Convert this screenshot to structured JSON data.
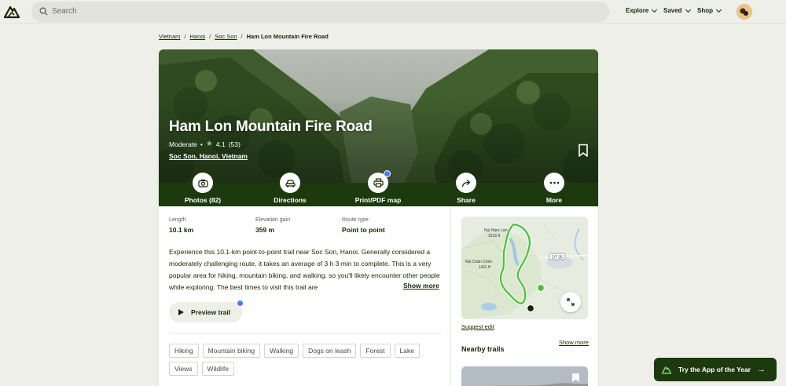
{
  "header": {
    "search_placeholder": "Search",
    "nav": [
      {
        "label": "Explore"
      },
      {
        "label": "Saved"
      },
      {
        "label": "Shop"
      }
    ]
  },
  "breadcrumb": [
    "Vietnam",
    "Hanoi",
    "Soc Son",
    "Ham Lon Mountain Fire Road"
  ],
  "trail": {
    "title": "Ham Lon Mountain Fire Road",
    "difficulty": "Moderate",
    "rating": "4.1",
    "review_count": "(53)",
    "location": "Soc Son, Hanoi, Vietnam"
  },
  "actions": [
    {
      "label": "Photos (82)",
      "icon": "camera-icon"
    },
    {
      "label": "Directions",
      "icon": "car-icon"
    },
    {
      "label": "Print/PDF map",
      "icon": "printer-icon"
    },
    {
      "label": "Share",
      "icon": "share-icon"
    },
    {
      "label": "More",
      "icon": "more-icon"
    }
  ],
  "stats": [
    {
      "label": "Length",
      "value": "10.1 km"
    },
    {
      "label": "Elevation gain",
      "value": "359 m"
    },
    {
      "label": "Route type",
      "value": "Point to point"
    }
  ],
  "description": "Experience this 10.1-km point-to-point trail near Soc Son, Hanoi. Generally considered a moderately challenging route, it takes an average of 3 h 3 min to complete. This is a very popular area for hiking, mountain biking, and walking, so you'll likely encounter other people while exploring. The best times to visit this trail are",
  "show_more": "Show more",
  "preview_label": "Preview trail",
  "tags": [
    "Hiking",
    "Mountain biking",
    "Walking",
    "Dogs on leash",
    "Forest",
    "Lake",
    "Views",
    "Wildlife"
  ],
  "map": {
    "peak1": "Núi Hàm Lợn",
    "peak1_elev": "1516 ft",
    "peak2": "Núi Chân Chim",
    "peak2_elev": "1411 ft",
    "road": "DT 35"
  },
  "suggest_edit": "Suggest edit",
  "nearby": {
    "title": "Nearby trails",
    "show_more": "Show more"
  },
  "app_banner": "Try the App of the Year",
  "colors": {
    "brand_dark": "#1c3a0e",
    "accent_green": "#7ed36b",
    "badge_blue": "#4d7cf5",
    "trail_green": "#4bbf3b"
  }
}
